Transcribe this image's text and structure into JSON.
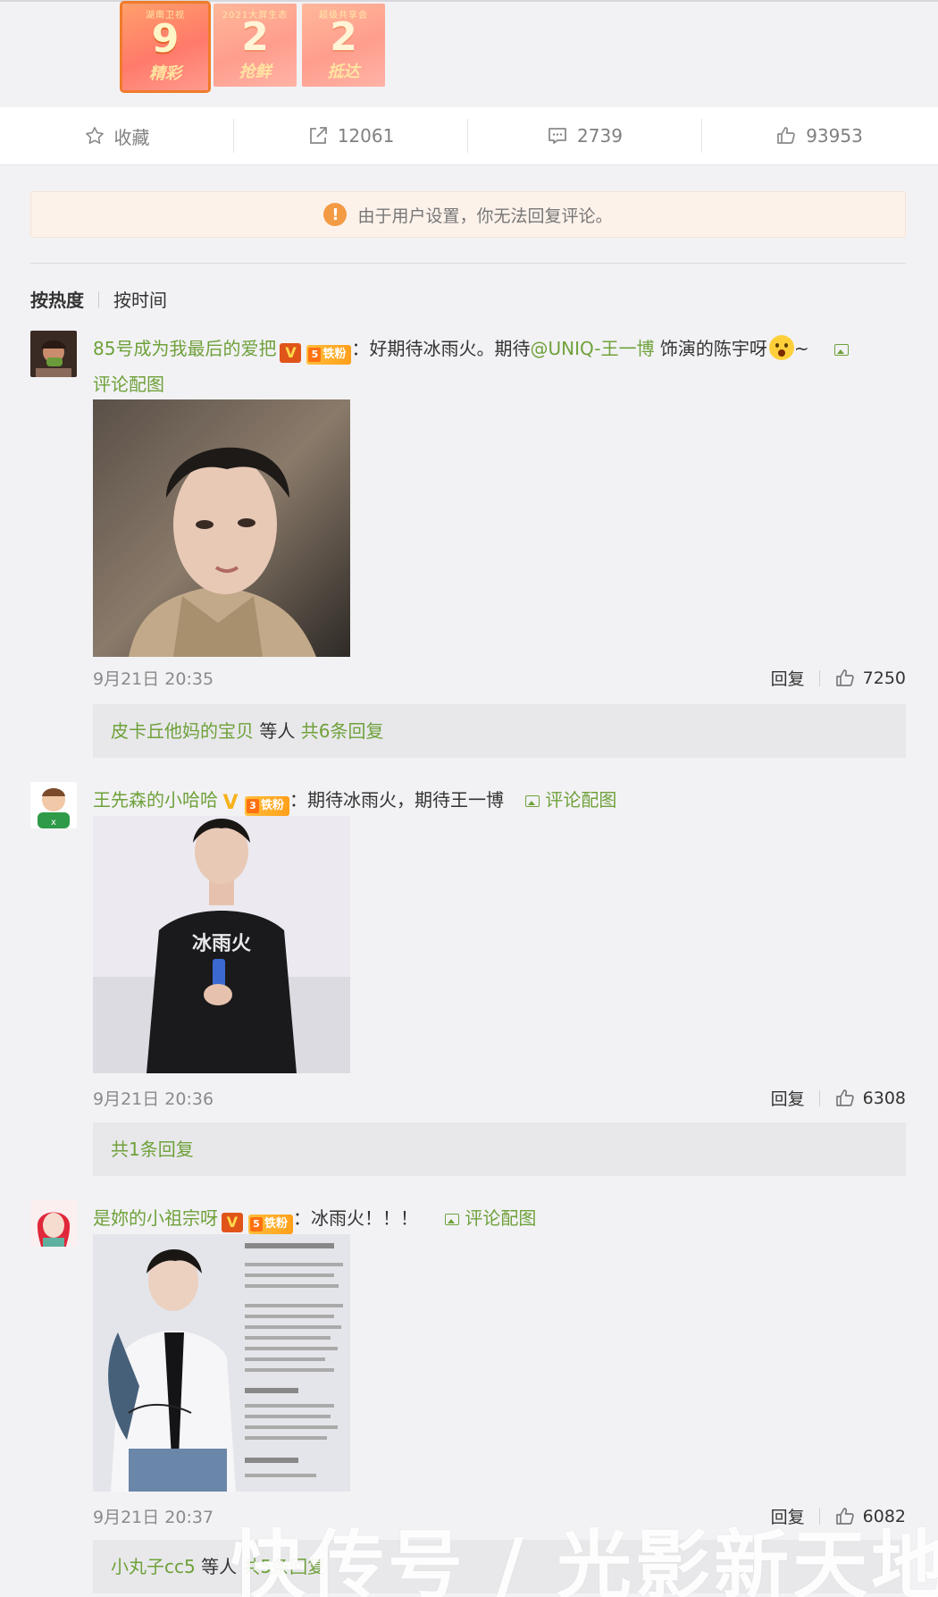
{
  "stickers": [
    {
      "top": "湖南卫视",
      "num": "9",
      "word": "精彩"
    },
    {
      "top": "2021大屏生态",
      "num": "2",
      "word": "抢鲜"
    },
    {
      "top": "超级共享会",
      "num": "2",
      "word": "抵达"
    }
  ],
  "actions": {
    "favorite": "收藏",
    "share_count": "12061",
    "comment_count": "2739",
    "like_count": "93953"
  },
  "notice": "由于用户设置，你无法回复评论。",
  "sort": {
    "hot": "按热度",
    "time": "按时间"
  },
  "comments": [
    {
      "user": "85号成为我最后的爱把",
      "verified": "V",
      "fan_level": "5",
      "fan_label": "铁粉",
      "text_a": "：好期待冰雨火。期待",
      "mention": "@UNIQ-王一博",
      "text_b": " 饰演的陈宇呀",
      "text_c": "~",
      "img_link": "评论配图",
      "time": "9月21日 20:35",
      "reply": "回复",
      "likes": "7250",
      "replies_from": "皮卡丘他妈的宝贝",
      "replies_mid": " 等人 ",
      "replies_count": "共6条回复"
    },
    {
      "user": "王先森的小哈哈",
      "verified": "V",
      "fan_level": "3",
      "fan_label": "铁粉",
      "text_a": "：期待冰雨火，期待王一博",
      "img_link": "评论配图",
      "time": "9月21日 20:36",
      "reply": "回复",
      "likes": "6308",
      "replies_count": "共1条回复"
    },
    {
      "user": "是妳的小祖宗呀",
      "verified": "V",
      "fan_level": "5",
      "fan_label": "铁粉",
      "text_a": "：冰雨火！！！",
      "img_link": "评论配图",
      "time": "9月21日 20:37",
      "reply": "回复",
      "likes": "6082",
      "replies_from": "小丸子cc5",
      "replies_mid": " 等人 ",
      "replies_count": "共5条回复"
    }
  ],
  "shirt_text": "冰雨火",
  "watermark": "快传号 / 光影新天地"
}
